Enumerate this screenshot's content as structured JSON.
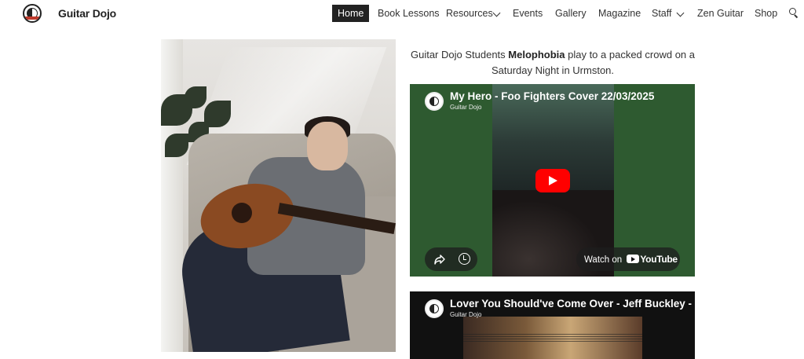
{
  "site": {
    "title": "Guitar Dojo"
  },
  "nav": {
    "items": [
      {
        "label": "Home",
        "active": true
      },
      {
        "label": "Book Lessons"
      },
      {
        "label": "Resources",
        "has_dropdown": true
      },
      {
        "label": "Events"
      },
      {
        "label": "Gallery"
      },
      {
        "label": "Magazine"
      },
      {
        "label": "Staff",
        "has_dropdown": true
      },
      {
        "label": "Zen Guitar"
      },
      {
        "label": "Shop"
      }
    ],
    "search_icon": "search-icon"
  },
  "caption": {
    "prefix": "Guitar Dojo Students ",
    "band": "Melophobia",
    "suffix": " play to a packed crowd on a Saturday Night in Urmston."
  },
  "videos": [
    {
      "title": "My Hero - Foo Fighters Cover 22/03/2025",
      "channel": "Guitar Dojo",
      "watch_label": "Watch on",
      "platform": "YouTube"
    },
    {
      "title": "Lover You Should've Come Over - Jeff Buckley - Bo",
      "channel": "Guitar Dojo"
    }
  ],
  "colors": {
    "nav_active_bg": "#222222",
    "play_button": "#ff0000",
    "video1_bg": "#2e5a30"
  }
}
